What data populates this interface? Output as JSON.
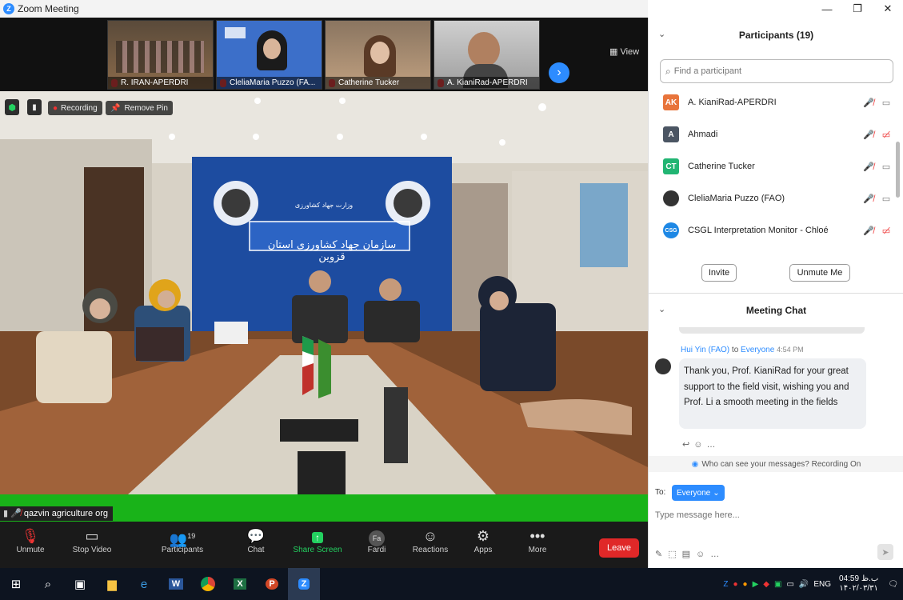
{
  "window": {
    "title": "Zoom Meeting",
    "controls": [
      "—",
      "❐",
      "✕"
    ]
  },
  "thumbnails": [
    {
      "name": "R. IRAN-APERDRI"
    },
    {
      "name": "CleliaMaria Puzzo (FA..."
    },
    {
      "name": "Catherine Tucker"
    },
    {
      "name": "A. KianiRad-APERDRI"
    }
  ],
  "view_label": "View",
  "main": {
    "recording_label": "Recording",
    "remove_pin_label": "Remove Pin",
    "banner_text": "سازمان جهاد کشاورزی استان قزوین",
    "banner_sub": "وزارت جهاد کشاورزی",
    "speaker_label": "qazvin agriculture org"
  },
  "toolbar": {
    "unmute": "Unmute",
    "stop_video": "Stop Video",
    "participants": "Participants",
    "participants_count": "19",
    "chat": "Chat",
    "share": "Share Screen",
    "fardi": "Fardi",
    "fardi_badge": "Fa",
    "reactions": "Reactions",
    "apps": "Apps",
    "more": "More",
    "leave": "Leave"
  },
  "participants": {
    "title": "Participants (19)",
    "search_placeholder": "Find a participant",
    "list": [
      {
        "initials": "AK",
        "name": "A. KianiRad-APERDRI",
        "color": "#e8743b"
      },
      {
        "initials": "A",
        "name": "Ahmadi",
        "color": "#4b5563"
      },
      {
        "initials": "CT",
        "name": "Catherine Tucker",
        "color": "#22b573"
      },
      {
        "initials": "",
        "name": "CleliaMaria Puzzo (FAO)",
        "color": "#333"
      },
      {
        "initials": "CSG",
        "name": "CSGL Interpretation Monitor - Chloé",
        "color": "#1e88e5"
      }
    ],
    "invite": "Invite",
    "unmute_me": "Unmute Me"
  },
  "chat": {
    "title": "Meeting Chat",
    "sender": "Hui Yin (FAO)",
    "to_word": "to",
    "recipient": "Everyone",
    "time": "4:54 PM",
    "message": "Thank you, Prof. KianiRad for your great support to the field visit, wishing you and Prof. Li a smooth meeting in the fields",
    "notice": "Who can see your messages? Recording On",
    "to_label": "To:",
    "to_value": "Everyone",
    "placeholder": "Type message here..."
  },
  "taskbar": {
    "lang": "ENG",
    "time": "04:59",
    "date": "۱۴۰۲/۰۳/۳۱",
    "day": "ب.ظ"
  }
}
